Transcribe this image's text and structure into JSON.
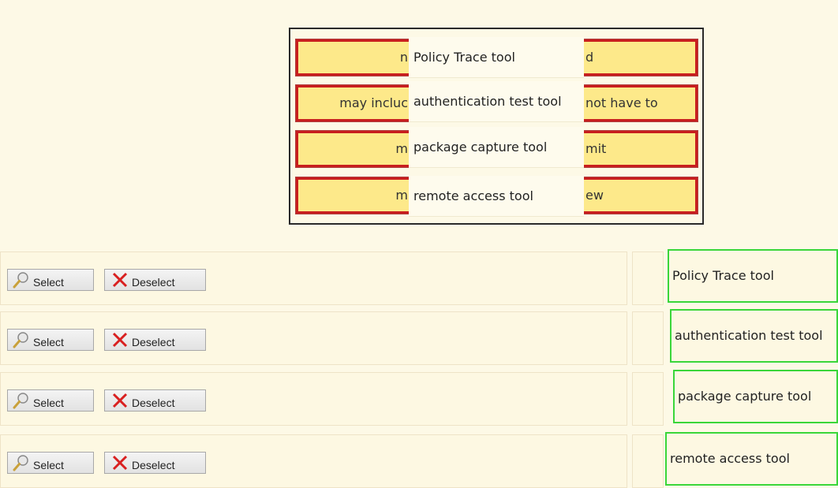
{
  "popup": {
    "statements": [
      {
        "left": "n",
        "right": "d"
      },
      {
        "left": "may incluc",
        "right": "not have to"
      },
      {
        "left": "m",
        "right": "mit"
      },
      {
        "left": "m",
        "right": "ew"
      }
    ],
    "dropdown_options": [
      "Policy Trace tool",
      "authentication test tool",
      "package capture tool",
      "remote access tool"
    ]
  },
  "rows": [
    {
      "select_label": "Select",
      "deselect_label": "Deselect",
      "answer": "Policy Trace tool"
    },
    {
      "select_label": "Select",
      "deselect_label": "Deselect",
      "answer": "authentication test tool"
    },
    {
      "select_label": "Select",
      "deselect_label": "Deselect",
      "answer": "package capture tool"
    },
    {
      "select_label": "Select",
      "deselect_label": "Deselect",
      "answer": "remote access tool"
    }
  ],
  "colors": {
    "background": "#fdf9e6",
    "statement_fill": "#fde98a",
    "statement_border": "#c81e1e",
    "answer_border": "#3ad63a"
  },
  "icons": {
    "select": "magnifier-icon",
    "deselect": "red-x-icon"
  }
}
